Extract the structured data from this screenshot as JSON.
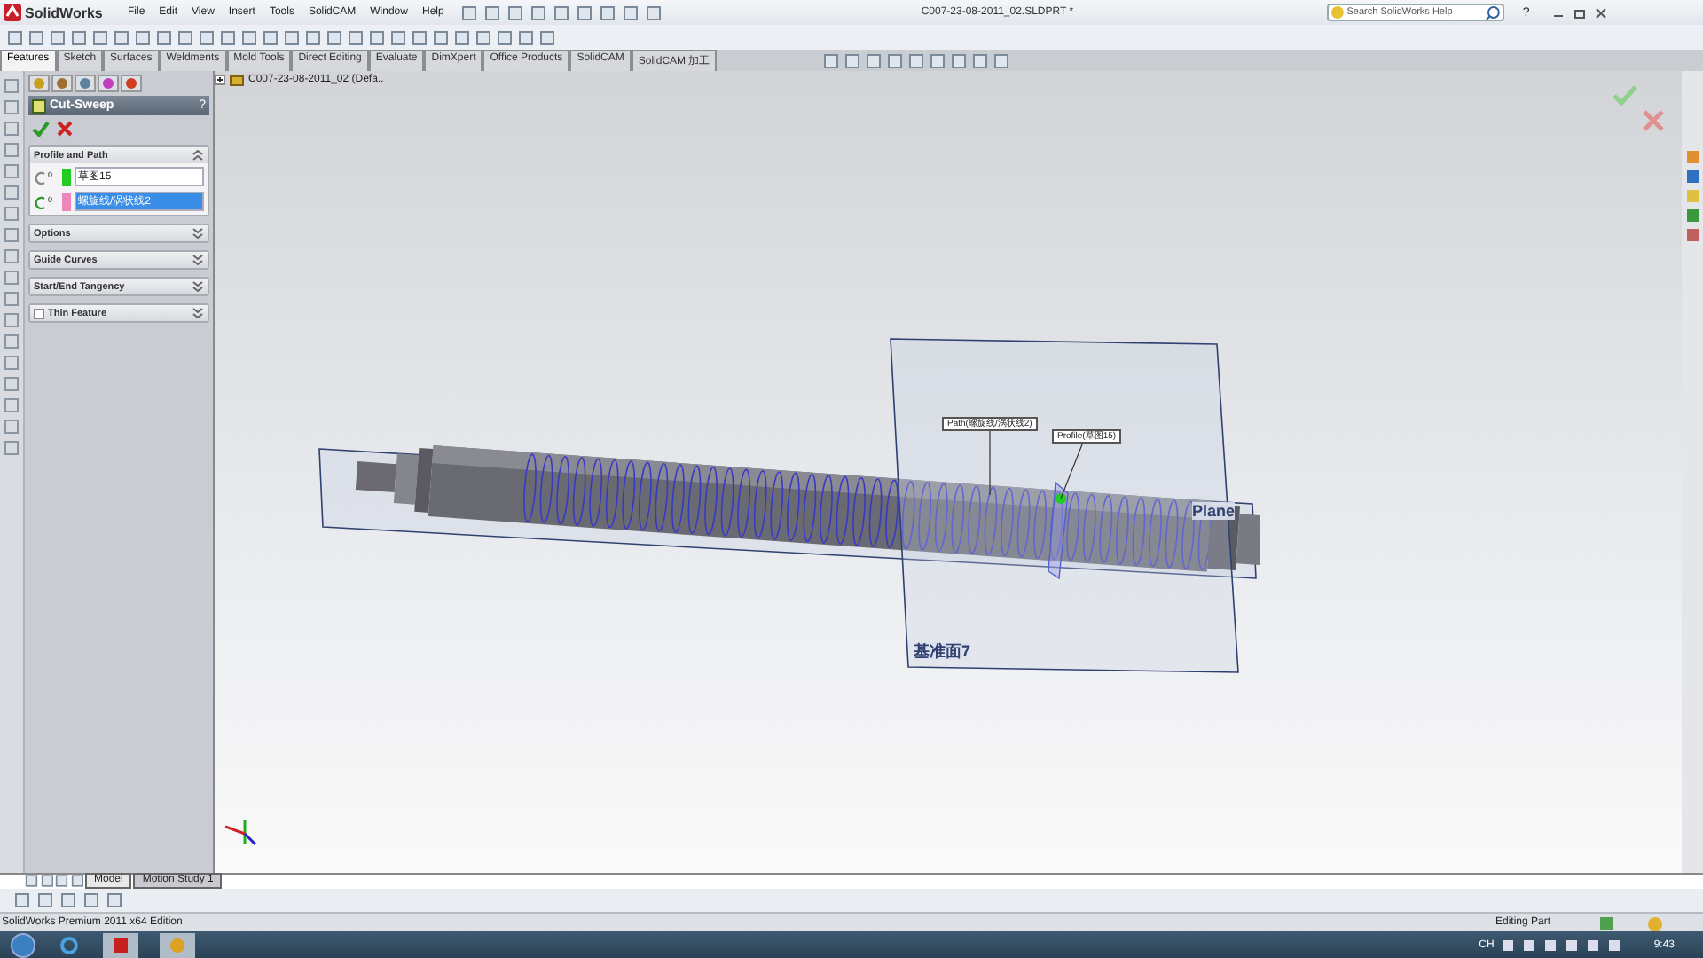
{
  "app": {
    "logo": "SolidWorks",
    "menus": [
      "File",
      "Edit",
      "View",
      "Insert",
      "Tools",
      "SolidCAM",
      "Window",
      "Help"
    ],
    "title": "C007-23-08-2011_02.SLDPRT *",
    "search": {
      "placeholder": "Search SolidWorks Help"
    },
    "help": "?"
  },
  "command_tabs": [
    {
      "label": "Features",
      "selected": true
    },
    {
      "label": "Sketch",
      "selected": false
    },
    {
      "label": "Surfaces",
      "selected": false
    },
    {
      "label": "Weldments",
      "selected": false
    },
    {
      "label": "Mold Tools",
      "selected": false
    },
    {
      "label": "Direct Editing",
      "selected": false
    },
    {
      "label": "Evaluate",
      "selected": false
    },
    {
      "label": "DimXpert",
      "selected": false
    },
    {
      "label": "Office Products",
      "selected": false
    },
    {
      "label": "SolidCAM",
      "selected": false
    },
    {
      "label": "SolidCAM 加工",
      "selected": false
    }
  ],
  "feature_tree": {
    "root": "C007-23-08-2011_02  (Defa.."
  },
  "property_manager": {
    "title": "Cut-Sweep",
    "help": "?",
    "sections": [
      {
        "kind": "group",
        "title": "Profile and Path",
        "expanded": true,
        "fields": [
          {
            "count": "0",
            "value": "草图15",
            "color": "#22cc22",
            "selected": false
          },
          {
            "count": "0",
            "value": "螺旋线/涡状线2",
            "color": "#ee88bb",
            "selected": true
          }
        ]
      },
      {
        "kind": "group",
        "title": "Options",
        "expanded": false
      },
      {
        "kind": "group",
        "title": "Guide Curves",
        "expanded": false
      },
      {
        "kind": "group",
        "title": "Start/End Tangency",
        "expanded": false
      },
      {
        "kind": "checkbox",
        "title": "Thin Feature",
        "expanded": false,
        "checked": false
      }
    ]
  },
  "viewport": {
    "callouts": [
      {
        "text": "Path(螺旋线/涡状线2)"
      },
      {
        "text": "Profile(草图15)"
      }
    ],
    "plane_labels": [
      {
        "text": "Plane"
      },
      {
        "text": "基准面7"
      }
    ]
  },
  "bottom_tabs": [
    {
      "label": "Model",
      "selected": true
    },
    {
      "label": "Motion Study 1",
      "selected": false
    }
  ],
  "status_bar": {
    "edition": "SolidWorks Premium 2011 x64 Edition",
    "mode": "Editing Part"
  },
  "taskbar": {
    "language": "CH",
    "clock": "9:43"
  }
}
